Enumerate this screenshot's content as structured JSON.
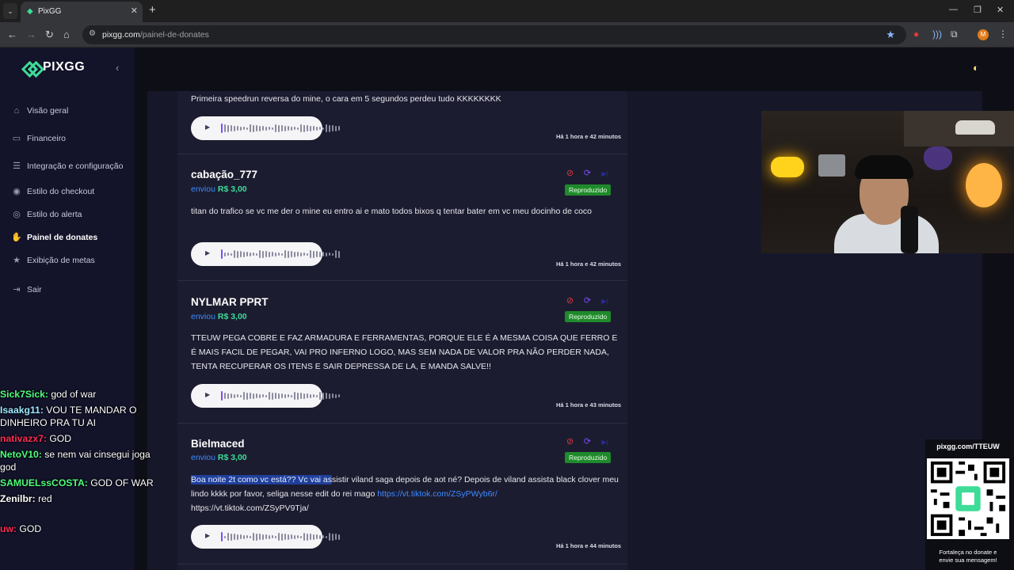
{
  "browser": {
    "tab_title": "PixGG",
    "url_host": "pixgg.com",
    "url_path": "/painel-de-donates",
    "profile_initial": "M"
  },
  "sidebar": {
    "logo": "PIXGG",
    "items": [
      {
        "label": "Visão geral",
        "icon": "home-icon"
      },
      {
        "label": "Financeiro",
        "icon": "wallet-icon"
      },
      {
        "label": "Integração e configuração",
        "icon": "settings-icon"
      },
      {
        "label": "Estilo do checkout",
        "icon": "palette-icon"
      },
      {
        "label": "Estilo do alerta",
        "icon": "palette-icon"
      },
      {
        "label": "Painel de donates",
        "icon": "donate-icon",
        "active": true
      },
      {
        "label": "Exibição de metas",
        "icon": "star-icon"
      },
      {
        "label": "Sair",
        "icon": "logout-icon"
      }
    ]
  },
  "donates": {
    "sent_word": "enviou",
    "items": [
      {
        "donor": "",
        "amount": "",
        "status": "",
        "message": "Primeira speedrun reversa do mine, o cara em 5 segundos perdeu tudo KKKKKKKK",
        "time": "Há 1 hora e 42 minutos"
      },
      {
        "donor": "cabação_777",
        "amount": "R$ 3,00",
        "status": "Reproduzido",
        "message": "titan do trafico se vc me der o mine eu entro ai e mato todos bixos q tentar bater em vc meu docinho de coco",
        "time": "Há 1 hora e 42 minutos"
      },
      {
        "donor": "NYLMAR PPRT",
        "amount": "R$ 3,00",
        "status": "Reproduzido",
        "message": "TTEUW PEGA COBRE E FAZ ARMADURA E FERRAMENTAS, PORQUE ELE É A MESMA COISA QUE FERRO E É MAIS FACIL DE PEGAR, VAI PRO INFERNO LOGO, MAS SEM NADA DE VALOR PRA NÃO PERDER NADA, TENTA RECUPERAR OS ITENS E SAIR DEPRESSA DE LA, E MANDA SALVE!!",
        "time": "Há 1 hora e 43 minutos"
      },
      {
        "donor": "Bielmaced",
        "amount": "R$ 3,00",
        "status": "Reproduzido",
        "message_highlight": "Boa noite 2t como vc está?? Vc vai as",
        "message_rest": "sistir viland saga depois de aot né? Depois de viland assista black clover meu lindo kkkk por favor, seliga nesse edit do rei mago ",
        "message_link": "https://vt.tiktok.com/ZSyPWyb6r/",
        "message_tail": "https://vt.tiktok.com/ZSyP​V9Tja/",
        "time": "Há 1 hora e 44 minutos"
      }
    ]
  },
  "chat": [
    {
      "user": "Sick7Sick:",
      "color": "#4dff7a",
      "msg": "god of war"
    },
    {
      "user": "Isaakg11:",
      "color": "#9be8ff",
      "msg": "VOU TE MANDAR O DINHEIRO PRA TU AI"
    },
    {
      "user": "nativazx7:",
      "color": "#ff2d55",
      "msg": "GOD"
    },
    {
      "user": "NetoV10:",
      "color": "#4dff7a",
      "msg": "se nem vai cinsegui joga god"
    },
    {
      "user": "SAMUELssCOSTA:",
      "color": "#4dff7a",
      "msg": "GOD OF WAR"
    },
    {
      "user": "Zenilbr:",
      "color": "#ffffff",
      "msg": "red"
    },
    {
      "user": "uw:",
      "color": "#ff2d55",
      "msg": "GOD"
    }
  ],
  "qr": {
    "url": "pixgg.com/TTEUW",
    "caption_line1": "Fortaleça no donate e",
    "caption_line2": "envie sua mensagem!"
  },
  "colors": {
    "accent": "#3ddc97",
    "link": "#3d8bff",
    "status_ok": "#1f8a2b",
    "block": "#e0353a",
    "replay": "#7b4dff"
  }
}
